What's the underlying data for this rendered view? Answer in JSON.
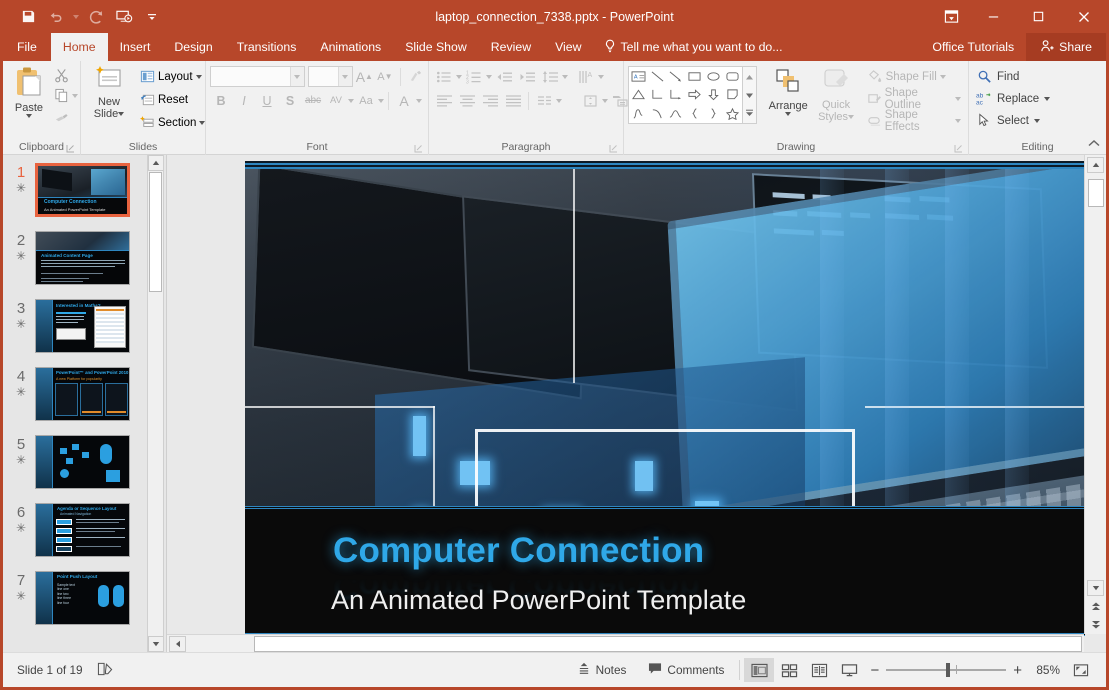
{
  "window": {
    "title": "laptop_connection_7338.pptx - PowerPoint",
    "quick_access": [
      {
        "name": "save",
        "icon": "save-icon"
      },
      {
        "name": "undo",
        "icon": "undo-icon"
      },
      {
        "name": "redo",
        "icon": "redo-icon"
      },
      {
        "name": "start-from-beginning",
        "icon": "slideshow-icon"
      },
      {
        "name": "customize-quick-access-toolbar",
        "icon": "chevron-down-icon"
      }
    ],
    "controls": {
      "ribbon_display_options": "ribbon-display-options-icon",
      "minimize": "minimize-icon",
      "restore": "restore-icon",
      "close": "close-icon"
    },
    "accent_color": "#b7472a"
  },
  "tabs": {
    "items": [
      {
        "label": "File",
        "active": false
      },
      {
        "label": "Home",
        "active": true
      },
      {
        "label": "Insert",
        "active": false
      },
      {
        "label": "Design",
        "active": false
      },
      {
        "label": "Transitions",
        "active": false
      },
      {
        "label": "Animations",
        "active": false
      },
      {
        "label": "Slide Show",
        "active": false
      },
      {
        "label": "Review",
        "active": false
      },
      {
        "label": "View",
        "active": false
      }
    ],
    "tell_me": "Tell me what you want to do...",
    "office_tutorials": "Office Tutorials",
    "share": "Share"
  },
  "ribbon": {
    "clipboard": {
      "label": "Clipboard",
      "paste": "Paste",
      "cut": "Cut",
      "copy": "Copy",
      "format_painter": "Format Painter"
    },
    "slides": {
      "label": "Slides",
      "new_slide": "New\nSlide",
      "new_slide_line1": "New",
      "new_slide_line2": "Slide",
      "layout": "Layout",
      "reset": "Reset",
      "section": "Section"
    },
    "font": {
      "label": "Font",
      "font_name": "",
      "font_size": "",
      "increase_font": "Increase Font Size",
      "decrease_font": "Decrease Font Size",
      "clear_formatting": "Clear All Formatting",
      "bold": "B",
      "italic": "I",
      "underline": "U",
      "shadow": "S",
      "strikethrough": "abc",
      "character_spacing": "AV",
      "change_case": "Aa",
      "font_color": "A"
    },
    "paragraph": {
      "label": "Paragraph",
      "bullets": "Bullets",
      "numbering": "Numbering",
      "decrease_indent": "Decrease List Level",
      "increase_indent": "Increase List Level",
      "line_spacing": "Line Spacing",
      "text_direction": "Text Direction",
      "align_text": "Align Text",
      "convert_smartart": "Convert to SmartArt",
      "align_left": "Align Left",
      "center": "Center",
      "align_right": "Align Right",
      "justify": "Justify",
      "columns": "Columns"
    },
    "drawing": {
      "label": "Drawing",
      "arrange": "Arrange",
      "quick_styles_line1": "Quick",
      "quick_styles_line2": "Styles",
      "shape_fill": "Shape Fill",
      "shape_outline": "Shape Outline",
      "shape_effects": "Shape Effects"
    },
    "editing": {
      "label": "Editing",
      "find": "Find",
      "replace": "Replace",
      "select": "Select"
    }
  },
  "thumbnails": {
    "slides": [
      {
        "number": "1",
        "selected": true
      },
      {
        "number": "2",
        "selected": false
      },
      {
        "number": "3",
        "selected": false
      },
      {
        "number": "4",
        "selected": false
      },
      {
        "number": "5",
        "selected": false
      },
      {
        "number": "6",
        "selected": false
      },
      {
        "number": "7",
        "selected": false
      }
    ],
    "animation_marker": "✳"
  },
  "slide": {
    "title": "Computer Connection",
    "subtitle": "An Animated PowerPoint Template",
    "title_color": "#2fa8e8",
    "band_color": "#0a0a0a",
    "accent_line_color": "#2e86c0"
  },
  "status_bar": {
    "slide_indicator": "Slide 1 of 19",
    "notes": "Notes",
    "comments": "Comments",
    "views": [
      {
        "name": "normal-view",
        "active": true
      },
      {
        "name": "slide-sorter-view",
        "active": false
      },
      {
        "name": "reading-view",
        "active": false
      },
      {
        "name": "slide-show-view",
        "active": false
      }
    ],
    "zoom_out": "−",
    "zoom_in": "+",
    "zoom_level": "85%",
    "fit_to_window": "fit-slide-icon"
  }
}
